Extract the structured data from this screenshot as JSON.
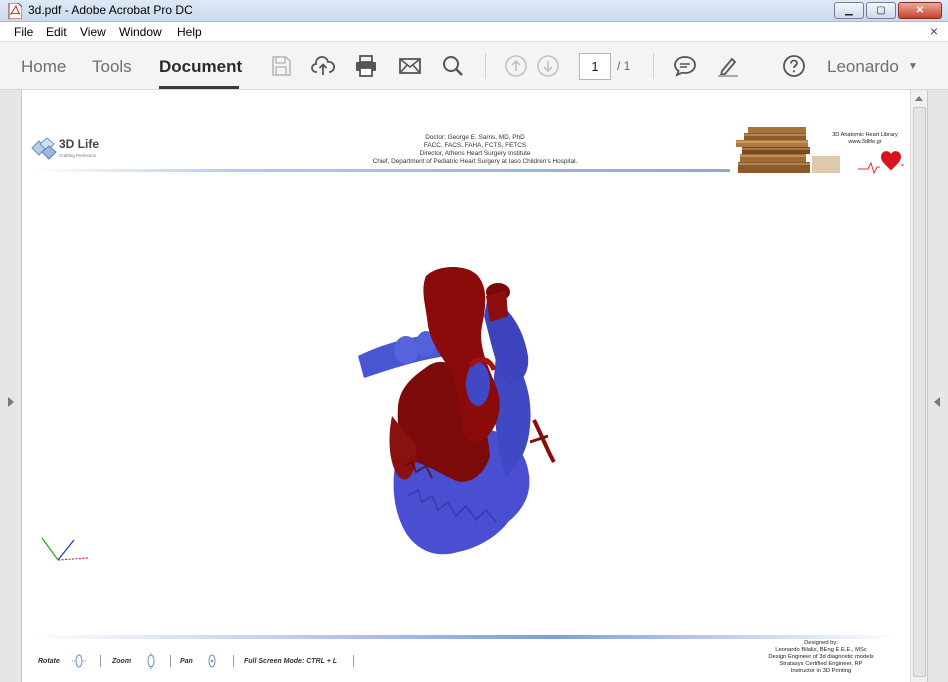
{
  "window": {
    "title": "3d.pdf - Adobe Acrobat Pro DC",
    "min_label": "▁",
    "max_label": "▢",
    "close_label": "✕"
  },
  "menubar": {
    "items": [
      "File",
      "Edit",
      "View",
      "Window",
      "Help"
    ],
    "close_doc": "×"
  },
  "toolbar": {
    "tabs": [
      "Home",
      "Tools",
      "Document"
    ],
    "active_tab": "Document",
    "page_current": "1",
    "page_total": "/  1",
    "user": "Leonardo",
    "icons": [
      "save-icon",
      "upload-icon",
      "print-icon",
      "mail-icon",
      "search-icon",
      "page-up-icon",
      "page-down-icon",
      "comment-icon",
      "highlight-icon",
      "help-icon"
    ]
  },
  "pdf_page": {
    "logo_name": "3D Life",
    "logo_tagline": "Crafting Perfection",
    "doctor_lines": [
      "Doctor: George E. Sarris, MD, PhD",
      "FACC, FACS, FAHA, FCTS, FETCS",
      "Director, Athens Heart Surgery Institute",
      "Chief, Department of Pediatric Heart Surgery at Iaso Children's Hospital."
    ],
    "library_lines": [
      "3D Anatomic Heart Library",
      "www.3dlife.gr"
    ],
    "controls": {
      "rotate": "Rotate",
      "zoom": "Zoom",
      "pan": "Pan",
      "fullscreen": "Full Screen Mode:  CTRL + L"
    },
    "designer_lines": [
      "Designed by:",
      "Leonardo Bilalis, BEng E.E.E., MSc",
      "Design Engineer of 3d diagnostic models",
      "Stratasys Certified Engineer, RP",
      "Instructor in 3D Printing"
    ]
  },
  "colors": {
    "heart_red": "#8b0a0a",
    "heart_blue": "#4a4fd1",
    "accent_blue": "#8ba6d8"
  }
}
